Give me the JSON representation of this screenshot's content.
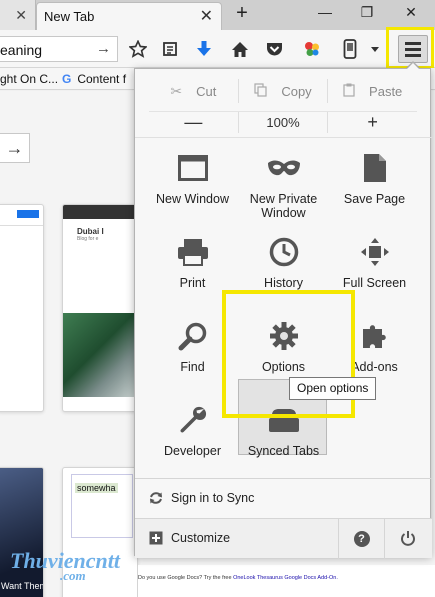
{
  "tabs": {
    "active_title": "New Tab",
    "close_symbol": "✕",
    "new_tab_symbol": "+"
  },
  "window": {
    "minimize": "—",
    "restore": "❐",
    "close": "✕"
  },
  "urlbar": {
    "value": "eaning",
    "go_symbol": "→"
  },
  "bookmarks": [
    {
      "label": "ght On C..."
    },
    {
      "label": "Content f",
      "icon": "G"
    }
  ],
  "content": {
    "arrow_symbol": "→",
    "thumb_site": "Dubai I",
    "thumb_tagline": "Blog for e",
    "left_thumb_caption": "Want Them",
    "doc_text": "somewha",
    "doc_footer_plain": "Do you use Google Docs? Try the free",
    "doc_footer_link": "OneLook Thesaurus Google Docs Add-On."
  },
  "menu": {
    "edit": {
      "cut": "Cut",
      "copy": "Copy",
      "paste": "Paste"
    },
    "zoom": {
      "minus": "—",
      "level": "100%",
      "plus": "+"
    },
    "items": [
      {
        "label": "New Window",
        "icon": "new-window-icon"
      },
      {
        "label": "New Private\nWindow",
        "icon": "private-mask-icon"
      },
      {
        "label": "Save Page",
        "icon": "save-page-icon"
      },
      {
        "label": "Print",
        "icon": "printer-icon"
      },
      {
        "label": "History",
        "icon": "clock-icon"
      },
      {
        "label": "Full Screen",
        "icon": "fullscreen-icon"
      },
      {
        "label": "Find",
        "icon": "magnifier-icon"
      },
      {
        "label": "Options",
        "icon": "gear-icon"
      },
      {
        "label": "Add-ons",
        "icon": "puzzle-icon"
      },
      {
        "label": "Developer",
        "icon": "wrench-icon"
      },
      {
        "label": "Synced Tabs",
        "icon": "synced-tabs-icon"
      }
    ],
    "tooltip": "Open options",
    "sign_in": "Sign in to Sync",
    "customize": "Customize",
    "help_symbol": "?",
    "highlight_color": "#f5e700"
  },
  "watermark": {
    "main": "Thuviencntt",
    "suffix": ".com"
  }
}
